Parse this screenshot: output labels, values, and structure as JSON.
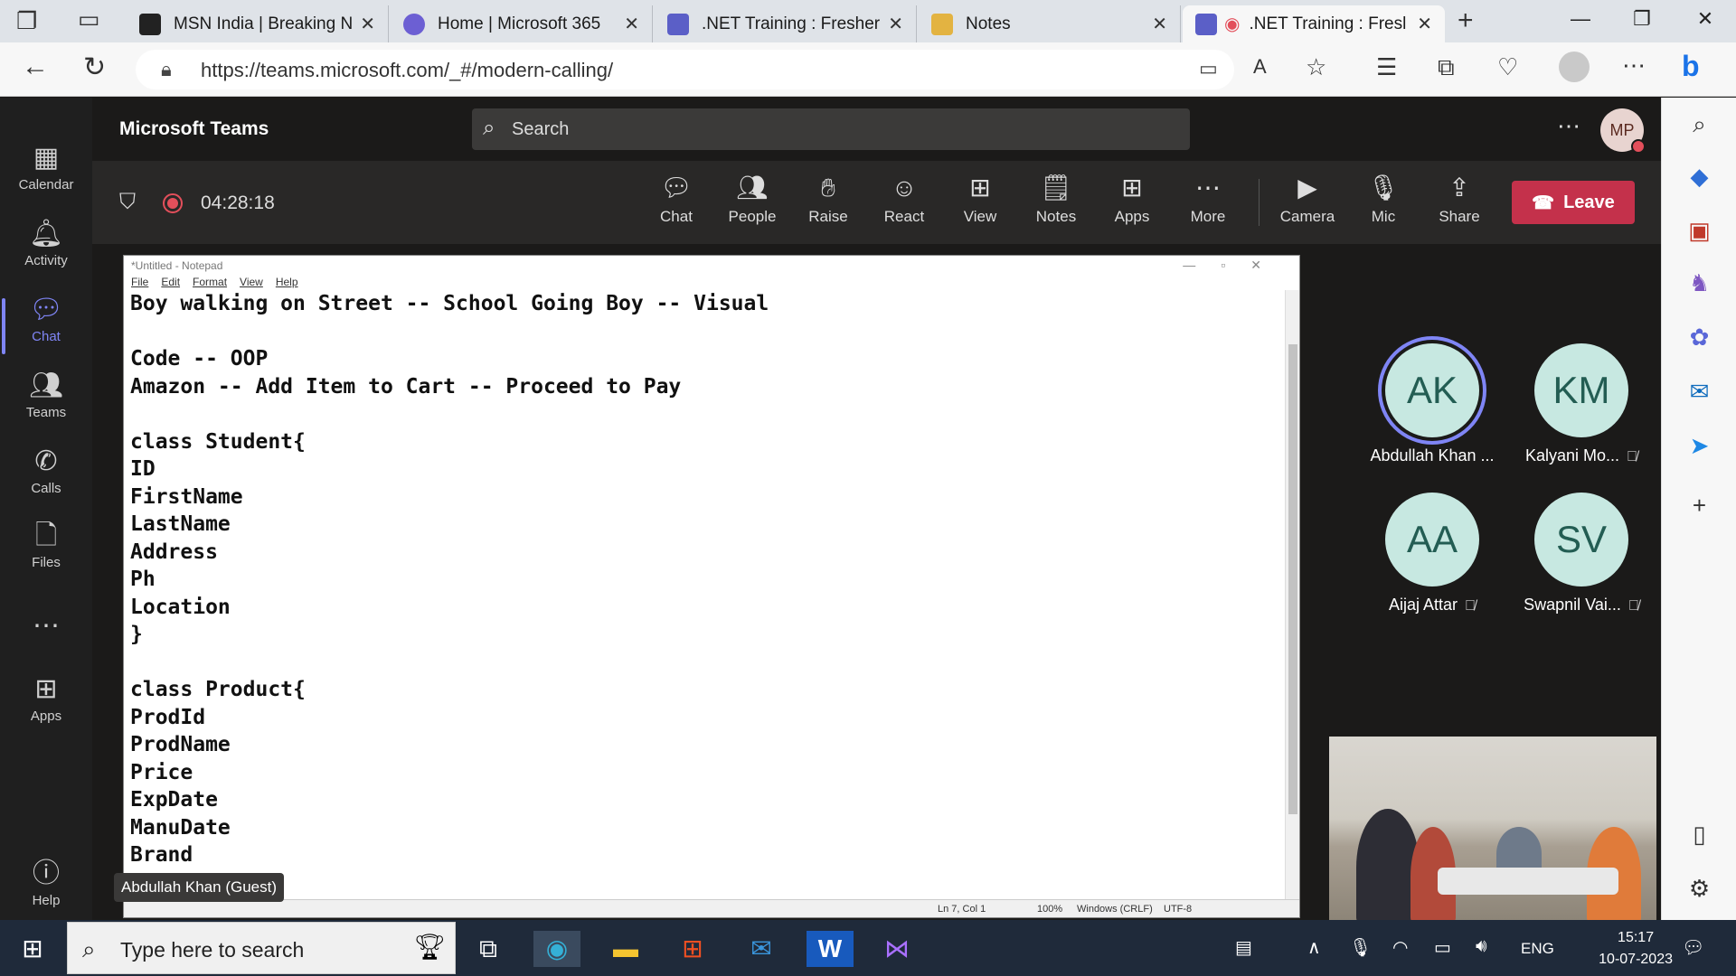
{
  "browser": {
    "tabs": [
      {
        "label": "MSN India | Breaking Ne",
        "color": "#ffffff"
      },
      {
        "label": "Home | Microsoft 365",
        "color": "#6c5fd3"
      },
      {
        "label": ".NET Training : Fresher B",
        "color": "#5b5fc7"
      },
      {
        "label": "Notes",
        "color": "#e3b341"
      },
      {
        "label": ".NET Training : Fresl",
        "color": "#5b5fc7"
      }
    ],
    "url": "https://teams.microsoft.com/_#/modern-calling/"
  },
  "teams": {
    "app_title": "Microsoft Teams",
    "search_placeholder": "Search",
    "avatar_initials": "MP",
    "rail": [
      {
        "label": "Calendar",
        "icon": "calendar-icon"
      },
      {
        "label": "Activity",
        "icon": "bell-icon"
      },
      {
        "label": "Chat",
        "icon": "chat-icon"
      },
      {
        "label": "Teams",
        "icon": "teams-icon"
      },
      {
        "label": "Calls",
        "icon": "phone-icon"
      },
      {
        "label": "Files",
        "icon": "file-icon"
      },
      {
        "label": "",
        "icon": "more-icon"
      },
      {
        "label": "Apps",
        "icon": "apps-icon"
      },
      {
        "label": "Help",
        "icon": "help-icon"
      }
    ]
  },
  "meeting": {
    "timer": "04:28:18",
    "toolbar": [
      {
        "label": "Chat"
      },
      {
        "label": "People"
      },
      {
        "label": "Raise"
      },
      {
        "label": "React"
      },
      {
        "label": "View"
      },
      {
        "label": "Notes"
      },
      {
        "label": "Apps"
      },
      {
        "label": "More"
      },
      {
        "label": "Camera"
      },
      {
        "label": "Mic"
      },
      {
        "label": "Share"
      }
    ],
    "leave_label": "Leave",
    "presenter_label": "Abdullah Khan (Guest)",
    "participants": [
      {
        "initials": "AK",
        "name": "Abdullah Khan ...",
        "muted": false
      },
      {
        "initials": "KM",
        "name": "Kalyani Mo...",
        "muted": true
      },
      {
        "initials": "AA",
        "name": "Aijaj Attar",
        "muted": true
      },
      {
        "initials": "SV",
        "name": "Swapnil Vai...",
        "muted": true
      }
    ]
  },
  "notepad": {
    "title": "*Untitled - Notepad",
    "menu": [
      "File",
      "Edit",
      "Format",
      "View",
      "Help"
    ],
    "lines": [
      "Boy walking on Street -- School Going Boy -- Visual",
      "",
      "Code -- OOP",
      "Amazon -- Add Item to Cart -- Proceed to Pay",
      "",
      "class Student{",
      "ID",
      "FirstName",
      "LastName",
      "Address",
      "Ph",
      "Location",
      "}",
      "",
      "class Product{",
      "ProdId",
      "ProdName",
      "Price",
      "ExpDate",
      "ManuDate",
      "Brand",
      "}"
    ],
    "status": {
      "position": "Ln 7, Col 1",
      "zoom": "100%",
      "line_ending": "Windows (CRLF)",
      "encoding": "UTF-8"
    }
  },
  "taskbar": {
    "search_placeholder": "Type here to search",
    "language": "ENG",
    "time": "15:17",
    "date": "10-07-2023"
  }
}
